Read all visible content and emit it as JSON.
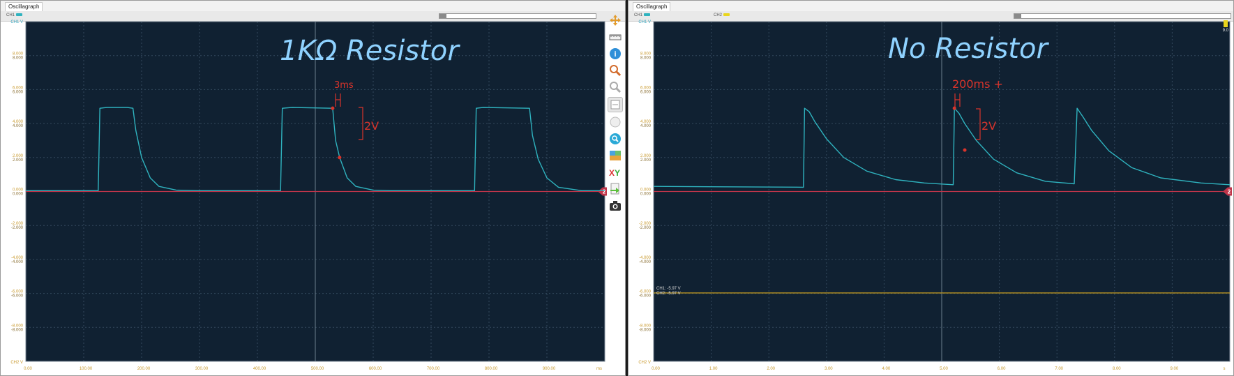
{
  "left": {
    "window_title": "Oscillagraph",
    "channel_chip": "CH1",
    "y_axis_top_label": "CH1 V",
    "y_axis_bottom_label": "CH2 V",
    "x_unit": "ms",
    "annotation_title": "1KΩ Resistor",
    "annotation_time": "3ms",
    "annotation_voltage": "2V",
    "y_ticks": [
      "8.000",
      "6.000",
      "4.000",
      "2.000",
      "0.000",
      "-2.000",
      "-4.000",
      "-6.000",
      "-8.000"
    ],
    "x_ticks": [
      "0.00",
      "100.00",
      "200.00",
      "300.00",
      "400.00",
      "500.00",
      "600.00",
      "700.00",
      "800.00",
      "900.00"
    ],
    "trigger_marker": "2"
  },
  "right": {
    "window_title": "Oscillagraph",
    "channel_chip_1": "CH1",
    "channel_chip_2": "CH2",
    "y_axis_top_label": "CH1 V",
    "y_axis_bottom_label": "CH2 V",
    "x_unit": "s",
    "annotation_title": "No Resistor",
    "annotation_time": "200ms +",
    "annotation_voltage": "2V",
    "ch1_readout": "CH1: -5.97 V",
    "ch2_readout": "CH2: -5.97 V",
    "corner_value": "9.0",
    "y_ticks": [
      "8.000",
      "6.000",
      "4.000",
      "2.000",
      "0.000",
      "-2.000",
      "-4.000",
      "-6.000",
      "-8.000"
    ],
    "x_ticks": [
      "0.00",
      "1.00",
      "2.00",
      "3.00",
      "4.00",
      "5.00",
      "6.00",
      "7.00",
      "8.00",
      "9.00"
    ],
    "trigger_marker": "2"
  },
  "tools": [
    "move-icon",
    "ruler-icon",
    "info-icon",
    "zoom-in-icon",
    "zoom-out-icon",
    "zoom-fit-icon",
    "zoom-reset-icon",
    "zoom-search-icon",
    "color-palette-icon",
    "xy-mode-icon",
    "export-icon",
    "camera-icon"
  ],
  "colors": {
    "plot_bg": "#102132",
    "grid": "#33495d",
    "ch1_trace": "#2fb3bf",
    "ch2_trace": "#b99423",
    "zero_line": "#c0354a",
    "tick_label": "#c99a2e",
    "annotation_blue": "#8fd2ff",
    "annotation_red": "#d9342b"
  },
  "chart_data": [
    {
      "type": "line",
      "title": "1KΩ Resistor",
      "xlabel": "ms",
      "ylabel": "CH1 V",
      "xlim": [
        0,
        1000
      ],
      "ylim": [
        -10,
        10
      ],
      "grid": true,
      "series": [
        {
          "name": "CH1",
          "x": [
            0,
            125,
            128,
            140,
            175,
            185,
            190,
            200,
            215,
            230,
            260,
            300,
            440,
            443,
            460,
            530,
            535,
            542,
            555,
            570,
            600,
            630,
            700,
            775,
            778,
            790,
            870,
            875,
            885,
            900,
            920,
            960,
            1000
          ],
          "y": [
            0.05,
            0.05,
            4.9,
            4.95,
            4.95,
            4.9,
            3.6,
            2.0,
            0.8,
            0.3,
            0.08,
            0.05,
            0.05,
            4.9,
            4.95,
            4.9,
            3.0,
            2.0,
            0.8,
            0.3,
            0.08,
            0.05,
            0.05,
            0.05,
            4.9,
            4.95,
            4.9,
            3.3,
            1.9,
            0.8,
            0.25,
            0.05,
            0.05
          ]
        }
      ],
      "annotations": [
        "3ms",
        "2V"
      ]
    },
    {
      "type": "line",
      "title": "No Resistor",
      "xlabel": "s",
      "ylabel": "CH1 V",
      "xlim": [
        0,
        10
      ],
      "ylim": [
        -10,
        10
      ],
      "grid": true,
      "series": [
        {
          "name": "CH1",
          "x": [
            0,
            2.6,
            2.62,
            2.7,
            2.8,
            3.0,
            3.3,
            3.7,
            4.2,
            4.7,
            5.2,
            5.22,
            5.3,
            5.4,
            5.6,
            5.9,
            6.3,
            6.8,
            7.3,
            7.35,
            7.45,
            7.6,
            7.9,
            8.3,
            8.8,
            9.5,
            10.0
          ],
          "y": [
            0.3,
            0.25,
            4.9,
            4.7,
            4.1,
            3.1,
            2.0,
            1.2,
            0.7,
            0.5,
            0.4,
            4.9,
            4.6,
            4.0,
            3.0,
            1.9,
            1.1,
            0.6,
            0.45,
            4.9,
            4.4,
            3.6,
            2.4,
            1.4,
            0.8,
            0.5,
            0.4
          ]
        },
        {
          "name": "CH2",
          "x": [
            0,
            10
          ],
          "y": [
            -5.97,
            -5.97
          ]
        }
      ],
      "annotations": [
        "200ms +",
        "2V"
      ]
    }
  ]
}
